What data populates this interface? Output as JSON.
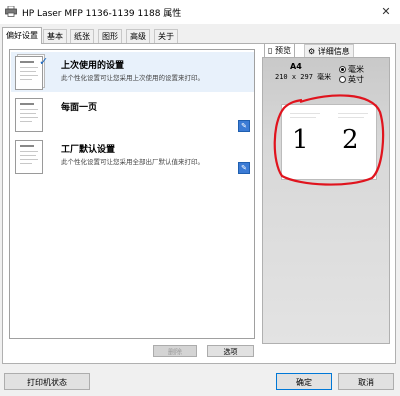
{
  "window": {
    "title": "HP Laser MFP 1136-1139 1188 属性",
    "close_glyph": "✕"
  },
  "tabs": [
    "偏好设置",
    "基本",
    "纸张",
    "图形",
    "高级",
    "关于"
  ],
  "presets": [
    {
      "name": "上次使用的设置",
      "desc": "此个性化设置可让您采用上次使用的设置来打印。",
      "selected": true
    },
    {
      "name": "每面一页",
      "desc": "",
      "selected": false
    },
    {
      "name": "工厂默认设置",
      "desc": "此个性化设置可让您采用全部出厂默认值来打印。",
      "selected": false
    }
  ],
  "list_buttons": {
    "delete": "删除",
    "options": "选项"
  },
  "preview_tabs": {
    "preview": "预览",
    "details": "详细信息"
  },
  "paper": {
    "size": "A4",
    "dimensions": "210 x 297 毫米"
  },
  "units": {
    "mm": "毫米",
    "inch": "英寸",
    "selected": "mm"
  },
  "preview_pages": [
    "1",
    "2"
  ],
  "footer": {
    "printer_status": "打印机状态",
    "ok": "确定",
    "cancel": "取消"
  },
  "colors": {
    "annotation": "#e0141e",
    "selection": "#e8f1fb",
    "accent": "#0078d7"
  }
}
